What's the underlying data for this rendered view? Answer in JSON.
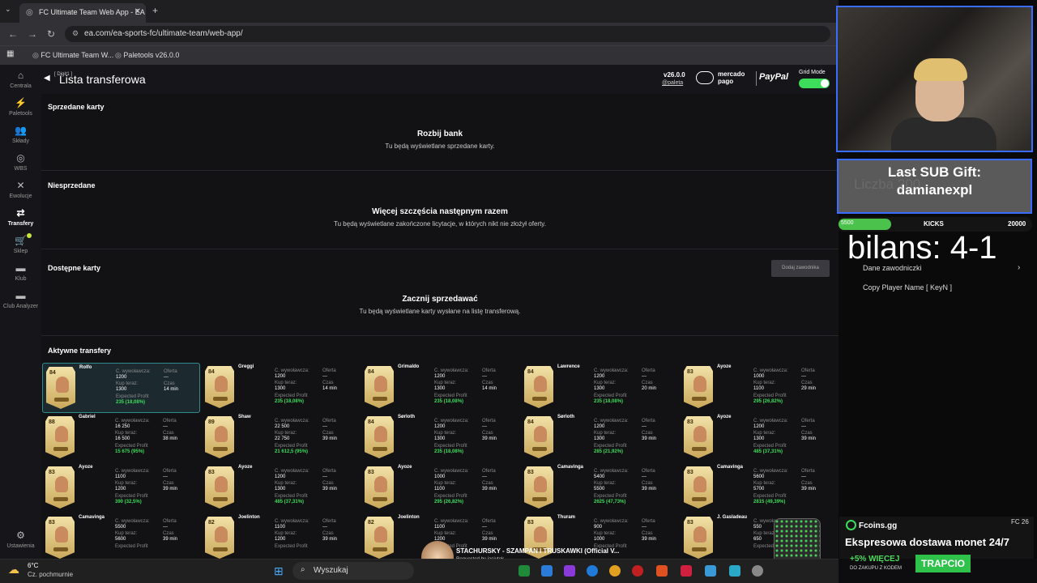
{
  "browser": {
    "tab_title": "FC Ultimate Team Web App - EA",
    "url": "ea.com/ea-sports-fc/ultimate-team/web-app/",
    "bookmarks": [
      "FC Ultimate Team W...",
      "Paletools v26.0.0"
    ]
  },
  "sidebar": {
    "items": [
      {
        "label": "Centrala",
        "icon": "home-icon"
      },
      {
        "label": "Paletools",
        "icon": "paletools-icon"
      },
      {
        "label": "Składy",
        "icon": "squad-icon"
      },
      {
        "label": "WBS",
        "icon": "target-icon"
      },
      {
        "label": "Ewolucje",
        "icon": "evolution-icon"
      },
      {
        "label": "Transfery",
        "icon": "transfer-icon"
      },
      {
        "label": "Sklep",
        "icon": "cart-icon"
      },
      {
        "label": "Klub",
        "icon": "club-icon"
      },
      {
        "label": "Club Analyzer",
        "icon": "analyzer-icon"
      },
      {
        "label": "Ustawienia",
        "icon": "gear-icon"
      }
    ]
  },
  "header": {
    "digit": "[ Digit1 ]",
    "title": "Lista transferowa",
    "version": "v26.0.0",
    "handle": "@paleta",
    "sponsor1": "mercado pago",
    "sponsor2": "PayPal",
    "grid_mode": "Grid Mode"
  },
  "sections": {
    "sold": {
      "title": "Sprzedane karty",
      "empty_title": "Rozbij bank",
      "empty_sub": "Tu będą wyświetlane sprzedane karty."
    },
    "unsold": {
      "title": "Niesprzedane",
      "empty_title": "Więcej szczęścia następnym razem",
      "empty_sub": "Tu będą wyświetlane zakończone licytacje, w których nikt nie złożył oferty."
    },
    "available": {
      "title": "Dostępne karty",
      "add_button": "Dodaj zawodnika",
      "empty_title": "Zacznij sprzedawać",
      "empty_sub": "Tu będą wyświetlane karty wysłane na listę transferową."
    },
    "active": {
      "title": "Aktywne transfery"
    }
  },
  "labels": {
    "start": "C. wywoławcza:",
    "buy": "Kup teraz:",
    "expected": "Expected Profit",
    "offer": "Oferta",
    "time": "Czas"
  },
  "transfers": [
    {
      "name": "Rolfo",
      "rating": "84",
      "start": "1200",
      "buy": "1300",
      "profit": "235 (18,08%)",
      "offer": "---",
      "time": "14 min"
    },
    {
      "name": "Greggi",
      "rating": "84",
      "start": "1200",
      "buy": "1300",
      "profit": "235 (18,08%)",
      "offer": "---",
      "time": "14 min"
    },
    {
      "name": "Grimaldo",
      "rating": "84",
      "start": "1200",
      "buy": "1300",
      "profit": "235 (18,08%)",
      "offer": "---",
      "time": "14 min"
    },
    {
      "name": "Lawrence",
      "rating": "84",
      "start": "1200",
      "buy": "1300",
      "profit": "235 (18,08%)",
      "offer": "---",
      "time": "20 min"
    },
    {
      "name": "Ayoze",
      "rating": "83",
      "start": "1000",
      "buy": "1100",
      "profit": "295 (26,82%)",
      "offer": "---",
      "time": "29 min"
    },
    {
      "name": "Gabriel",
      "rating": "88",
      "start": "16 250",
      "buy": "16 500",
      "profit": "15 675 (95%)",
      "offer": "---",
      "time": "38 min"
    },
    {
      "name": "Shaw",
      "rating": "89",
      "start": "22 500",
      "buy": "22 750",
      "profit": "21 612,5 (95%)",
      "offer": "---",
      "time": "39 min"
    },
    {
      "name": "Sørloth",
      "rating": "84",
      "start": "1200",
      "buy": "1300",
      "profit": "235 (18,08%)",
      "offer": "---",
      "time": "39 min"
    },
    {
      "name": "Sørloth",
      "rating": "84",
      "start": "1200",
      "buy": "1300",
      "profit": "285 (21,92%)",
      "offer": "---",
      "time": "39 min"
    },
    {
      "name": "Ayoze",
      "rating": "83",
      "start": "1200",
      "buy": "1300",
      "profit": "485 (37,31%)",
      "offer": "---",
      "time": "39 min"
    },
    {
      "name": "Ayoze",
      "rating": "83",
      "start": "1100",
      "buy": "1200",
      "profit": "390 (32,5%)",
      "offer": "---",
      "time": "39 min"
    },
    {
      "name": "Ayoze",
      "rating": "83",
      "start": "1200",
      "buy": "1300",
      "profit": "485 (37,31%)",
      "offer": "---",
      "time": "39 min"
    },
    {
      "name": "Ayoze",
      "rating": "83",
      "start": "1000",
      "buy": "1100",
      "profit": "295 (26,82%)",
      "offer": "---",
      "time": "39 min"
    },
    {
      "name": "Camavinga",
      "rating": "83",
      "start": "5400",
      "buy": "5500",
      "profit": "2625 (47,73%)",
      "offer": "---",
      "time": "39 min"
    },
    {
      "name": "Camavinga",
      "rating": "83",
      "start": "5600",
      "buy": "5700",
      "profit": "2815 (49,39%)",
      "offer": "---",
      "time": "39 min"
    },
    {
      "name": "Camavinga",
      "rating": "83",
      "start": "5500",
      "buy": "5600",
      "profit": "",
      "offer": "---",
      "time": "39 min"
    },
    {
      "name": "Joelinton",
      "rating": "82",
      "start": "1100",
      "buy": "1200",
      "profit": "",
      "offer": "---",
      "time": "39 min"
    },
    {
      "name": "Joelinton",
      "rating": "82",
      "start": "1100",
      "buy": "1200",
      "profit": "",
      "offer": "---",
      "time": "39 min"
    },
    {
      "name": "Thuram",
      "rating": "83",
      "start": "900",
      "buy": "1000",
      "profit": "",
      "offer": "---",
      "time": "39 min"
    },
    {
      "name": "J. Gasladeau",
      "rating": "83",
      "start": "550",
      "buy": "650",
      "profit": "",
      "offer": "---",
      "time": "39 min"
    }
  ],
  "stream": {
    "sub_gift_label": "Last SUB Gift:",
    "sub_gift_name": "damianexpl",
    "sub_ghost": "Liczba 200",
    "kicks_current": "5500",
    "kicks_label": "KICKS",
    "kicks_target": "20000",
    "kicks_progress": 0.275,
    "bilans": "bilans: 4-1",
    "dane": "Dane zawodniczki",
    "copy_name": "Copy Player Name [ KeyN ]"
  },
  "music": {
    "title": "STACHURSKY - SZAMPAN I TRUSKAWKI (Official V...",
    "requested": "Requested by jasiutek"
  },
  "ad": {
    "brand": "Fcoins.gg",
    "title": "Ekspresowa dostawa monet 24/7",
    "promo": "+5% WIĘCEJ",
    "promo_sub": "DO ZAKUPU Z KODEM",
    "button": "TRAPCIO",
    "tag": "FC 26"
  },
  "taskbar": {
    "temp": "6°C",
    "weather": "Cz. pochmurnie",
    "search": "Wyszukaj"
  }
}
